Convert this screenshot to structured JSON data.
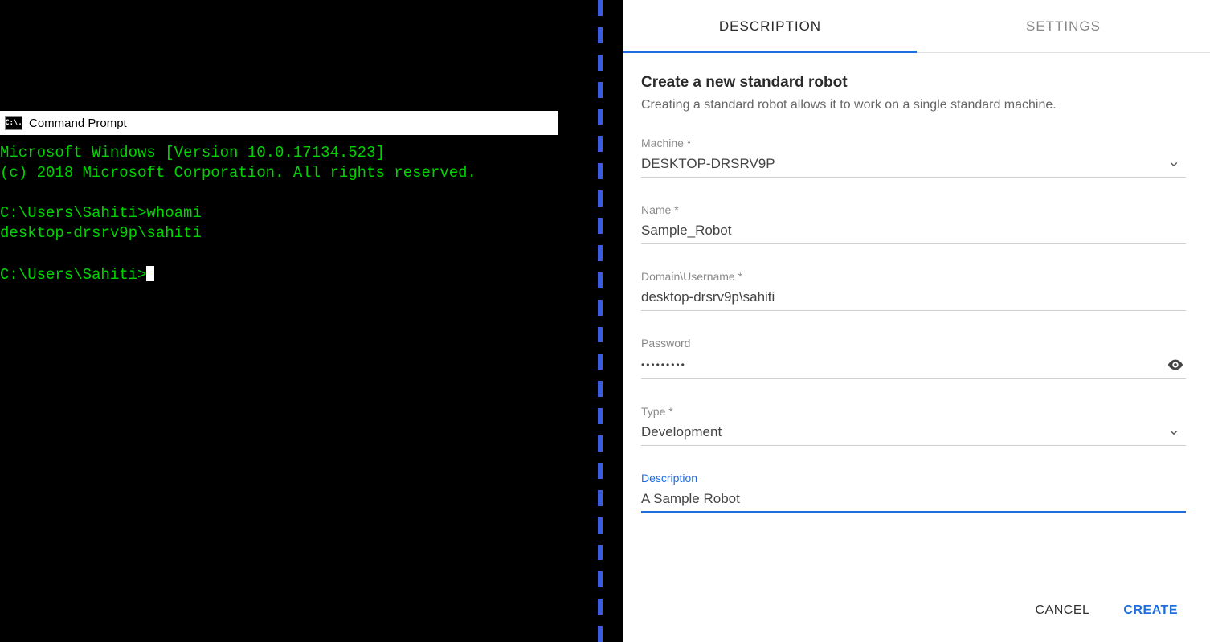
{
  "cmd": {
    "title": "Command Prompt",
    "icon_text": "C:\\.",
    "line1": "Microsoft Windows [Version 10.0.17134.523]",
    "line2": "(c) 2018 Microsoft Corporation. All rights reserved.",
    "line3": "",
    "line4": "C:\\Users\\Sahiti>whoami",
    "line5": "desktop-drsrv9p\\sahiti",
    "line6": "",
    "line7": "C:\\Users\\Sahiti>"
  },
  "tabs": {
    "description": "DESCRIPTION",
    "settings": "SETTINGS"
  },
  "form": {
    "title": "Create a new standard robot",
    "subtitle": "Creating a standard robot allows it to work on a single standard machine.",
    "machine_label": "Machine *",
    "machine_value": "DESKTOP-DRSRV9P",
    "name_label": "Name *",
    "name_value": "Sample_Robot",
    "domain_label": "Domain\\Username *",
    "domain_value": "desktop-drsrv9p\\sahiti",
    "password_label": "Password",
    "password_value": "•••••••••",
    "type_label": "Type *",
    "type_value": "Development",
    "description_label": "Description",
    "description_value": "A Sample Robot"
  },
  "actions": {
    "cancel": "CANCEL",
    "create": "CREATE"
  }
}
